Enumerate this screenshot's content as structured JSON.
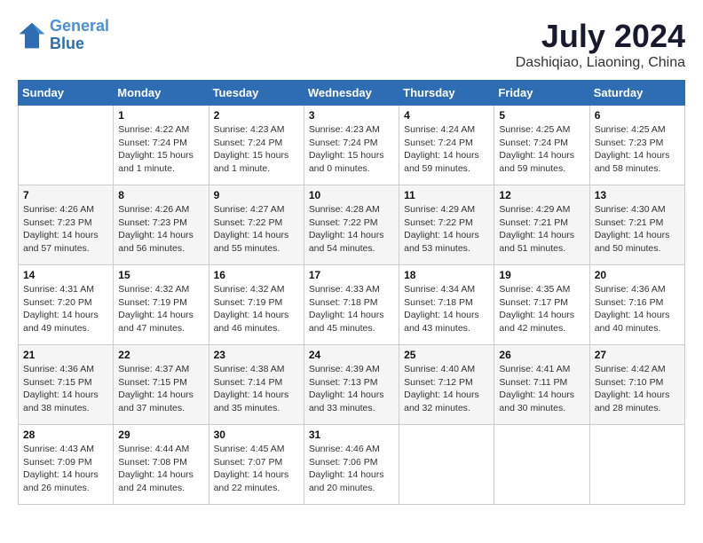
{
  "logo": {
    "line1": "General",
    "line2": "Blue"
  },
  "title": "July 2024",
  "subtitle": "Dashiqiao, Liaoning, China",
  "days_of_week": [
    "Sunday",
    "Monday",
    "Tuesday",
    "Wednesday",
    "Thursday",
    "Friday",
    "Saturday"
  ],
  "weeks": [
    [
      {
        "day": "",
        "sunrise": "",
        "sunset": "",
        "daylight": ""
      },
      {
        "day": "1",
        "sunrise": "Sunrise: 4:22 AM",
        "sunset": "Sunset: 7:24 PM",
        "daylight": "Daylight: 15 hours and 1 minute."
      },
      {
        "day": "2",
        "sunrise": "Sunrise: 4:23 AM",
        "sunset": "Sunset: 7:24 PM",
        "daylight": "Daylight: 15 hours and 1 minute."
      },
      {
        "day": "3",
        "sunrise": "Sunrise: 4:23 AM",
        "sunset": "Sunset: 7:24 PM",
        "daylight": "Daylight: 15 hours and 0 minutes."
      },
      {
        "day": "4",
        "sunrise": "Sunrise: 4:24 AM",
        "sunset": "Sunset: 7:24 PM",
        "daylight": "Daylight: 14 hours and 59 minutes."
      },
      {
        "day": "5",
        "sunrise": "Sunrise: 4:25 AM",
        "sunset": "Sunset: 7:24 PM",
        "daylight": "Daylight: 14 hours and 59 minutes."
      },
      {
        "day": "6",
        "sunrise": "Sunrise: 4:25 AM",
        "sunset": "Sunset: 7:23 PM",
        "daylight": "Daylight: 14 hours and 58 minutes."
      }
    ],
    [
      {
        "day": "7",
        "sunrise": "Sunrise: 4:26 AM",
        "sunset": "Sunset: 7:23 PM",
        "daylight": "Daylight: 14 hours and 57 minutes."
      },
      {
        "day": "8",
        "sunrise": "Sunrise: 4:26 AM",
        "sunset": "Sunset: 7:23 PM",
        "daylight": "Daylight: 14 hours and 56 minutes."
      },
      {
        "day": "9",
        "sunrise": "Sunrise: 4:27 AM",
        "sunset": "Sunset: 7:22 PM",
        "daylight": "Daylight: 14 hours and 55 minutes."
      },
      {
        "day": "10",
        "sunrise": "Sunrise: 4:28 AM",
        "sunset": "Sunset: 7:22 PM",
        "daylight": "Daylight: 14 hours and 54 minutes."
      },
      {
        "day": "11",
        "sunrise": "Sunrise: 4:29 AM",
        "sunset": "Sunset: 7:22 PM",
        "daylight": "Daylight: 14 hours and 53 minutes."
      },
      {
        "day": "12",
        "sunrise": "Sunrise: 4:29 AM",
        "sunset": "Sunset: 7:21 PM",
        "daylight": "Daylight: 14 hours and 51 minutes."
      },
      {
        "day": "13",
        "sunrise": "Sunrise: 4:30 AM",
        "sunset": "Sunset: 7:21 PM",
        "daylight": "Daylight: 14 hours and 50 minutes."
      }
    ],
    [
      {
        "day": "14",
        "sunrise": "Sunrise: 4:31 AM",
        "sunset": "Sunset: 7:20 PM",
        "daylight": "Daylight: 14 hours and 49 minutes."
      },
      {
        "day": "15",
        "sunrise": "Sunrise: 4:32 AM",
        "sunset": "Sunset: 7:19 PM",
        "daylight": "Daylight: 14 hours and 47 minutes."
      },
      {
        "day": "16",
        "sunrise": "Sunrise: 4:32 AM",
        "sunset": "Sunset: 7:19 PM",
        "daylight": "Daylight: 14 hours and 46 minutes."
      },
      {
        "day": "17",
        "sunrise": "Sunrise: 4:33 AM",
        "sunset": "Sunset: 7:18 PM",
        "daylight": "Daylight: 14 hours and 45 minutes."
      },
      {
        "day": "18",
        "sunrise": "Sunrise: 4:34 AM",
        "sunset": "Sunset: 7:18 PM",
        "daylight": "Daylight: 14 hours and 43 minutes."
      },
      {
        "day": "19",
        "sunrise": "Sunrise: 4:35 AM",
        "sunset": "Sunset: 7:17 PM",
        "daylight": "Daylight: 14 hours and 42 minutes."
      },
      {
        "day": "20",
        "sunrise": "Sunrise: 4:36 AM",
        "sunset": "Sunset: 7:16 PM",
        "daylight": "Daylight: 14 hours and 40 minutes."
      }
    ],
    [
      {
        "day": "21",
        "sunrise": "Sunrise: 4:36 AM",
        "sunset": "Sunset: 7:15 PM",
        "daylight": "Daylight: 14 hours and 38 minutes."
      },
      {
        "day": "22",
        "sunrise": "Sunrise: 4:37 AM",
        "sunset": "Sunset: 7:15 PM",
        "daylight": "Daylight: 14 hours and 37 minutes."
      },
      {
        "day": "23",
        "sunrise": "Sunrise: 4:38 AM",
        "sunset": "Sunset: 7:14 PM",
        "daylight": "Daylight: 14 hours and 35 minutes."
      },
      {
        "day": "24",
        "sunrise": "Sunrise: 4:39 AM",
        "sunset": "Sunset: 7:13 PM",
        "daylight": "Daylight: 14 hours and 33 minutes."
      },
      {
        "day": "25",
        "sunrise": "Sunrise: 4:40 AM",
        "sunset": "Sunset: 7:12 PM",
        "daylight": "Daylight: 14 hours and 32 minutes."
      },
      {
        "day": "26",
        "sunrise": "Sunrise: 4:41 AM",
        "sunset": "Sunset: 7:11 PM",
        "daylight": "Daylight: 14 hours and 30 minutes."
      },
      {
        "day": "27",
        "sunrise": "Sunrise: 4:42 AM",
        "sunset": "Sunset: 7:10 PM",
        "daylight": "Daylight: 14 hours and 28 minutes."
      }
    ],
    [
      {
        "day": "28",
        "sunrise": "Sunrise: 4:43 AM",
        "sunset": "Sunset: 7:09 PM",
        "daylight": "Daylight: 14 hours and 26 minutes."
      },
      {
        "day": "29",
        "sunrise": "Sunrise: 4:44 AM",
        "sunset": "Sunset: 7:08 PM",
        "daylight": "Daylight: 14 hours and 24 minutes."
      },
      {
        "day": "30",
        "sunrise": "Sunrise: 4:45 AM",
        "sunset": "Sunset: 7:07 PM",
        "daylight": "Daylight: 14 hours and 22 minutes."
      },
      {
        "day": "31",
        "sunrise": "Sunrise: 4:46 AM",
        "sunset": "Sunset: 7:06 PM",
        "daylight": "Daylight: 14 hours and 20 minutes."
      },
      {
        "day": "",
        "sunrise": "",
        "sunset": "",
        "daylight": ""
      },
      {
        "day": "",
        "sunrise": "",
        "sunset": "",
        "daylight": ""
      },
      {
        "day": "",
        "sunrise": "",
        "sunset": "",
        "daylight": ""
      }
    ]
  ]
}
